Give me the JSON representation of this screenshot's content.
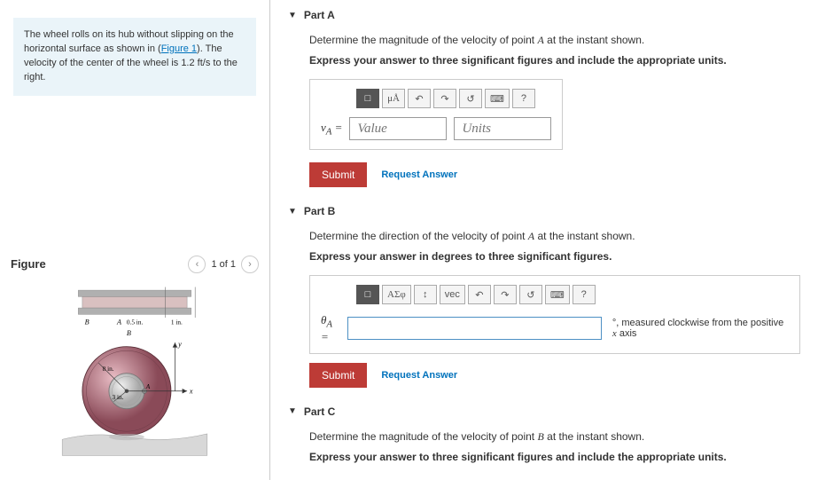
{
  "problem": {
    "text_pre": "The wheel rolls on its hub without slipping on the horizontal surface as shown in (",
    "link": "Figure 1",
    "text_post": "). The velocity of the center of the wheel is 1.2 ft/s to the right."
  },
  "figure": {
    "title": "Figure",
    "pager": "1 of 1",
    "labels": {
      "B": "B",
      "A": "A",
      "dimA": "0.5 in.",
      "dim1": "1 in.",
      "r8": "8 in.",
      "r3": "3 in.",
      "x": "x",
      "y": "y"
    }
  },
  "parts": {
    "a": {
      "title": "Part A",
      "prompt_pre": "Determine the magnitude of the velocity of point ",
      "prompt_var": "A",
      "prompt_post": " at the instant shown.",
      "instruction": "Express your answer to three significant figures and include the appropriate units.",
      "label": "v_A =",
      "value_ph": "Value",
      "units_ph": "Units",
      "submit": "Submit",
      "request": "Request Answer",
      "tools": {
        "templates": "□",
        "units": "μÅ",
        "undo": "↶",
        "redo": "↷",
        "reset": "↺",
        "keyboard": "⌨",
        "help": "?"
      }
    },
    "b": {
      "title": "Part B",
      "prompt_pre": "Determine the direction of the velocity of point ",
      "prompt_var": "A",
      "prompt_post": " at the instant shown.",
      "instruction": "Express your answer in degrees to three significant figures.",
      "label": "θ_A =",
      "suffix_deg": "°",
      "suffix_text": ", measured clockwise from the positive ",
      "suffix_var": "x",
      "suffix_text2": " axis",
      "submit": "Submit",
      "request": "Request Answer",
      "tools": {
        "templates": "□",
        "greek": "ΑΣφ",
        "scripts": "↕",
        "vec": "vec",
        "undo": "↶",
        "redo": "↷",
        "reset": "↺",
        "keyboard": "⌨",
        "help": "?"
      }
    },
    "c": {
      "title": "Part C",
      "prompt_pre": "Determine the magnitude of the velocity of point ",
      "prompt_var": "B",
      "prompt_post": " at the instant shown.",
      "instruction": "Express your answer to three significant figures and include the appropriate units."
    }
  }
}
